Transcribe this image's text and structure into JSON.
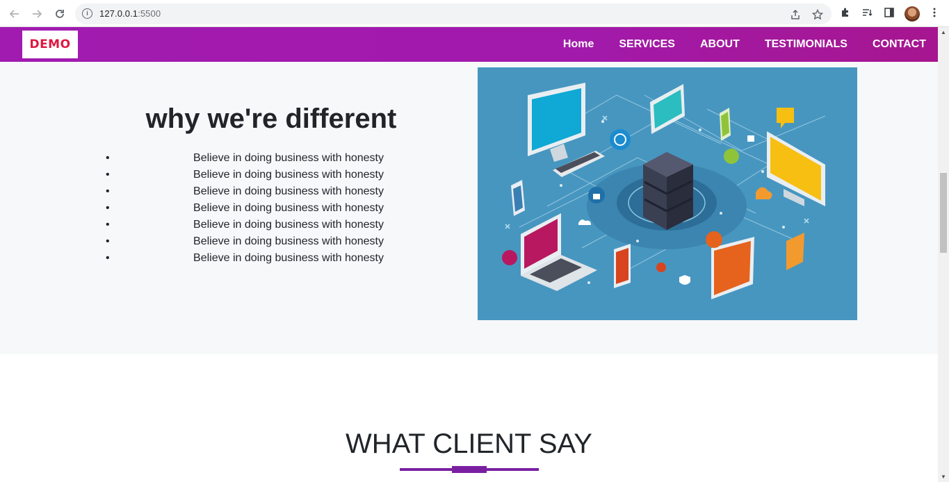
{
  "browser": {
    "url_host": "127.0.0.1",
    "url_port": ":5500",
    "back_icon": "back-arrow-icon",
    "forward_icon": "forward-arrow-icon",
    "reload_icon": "reload-icon"
  },
  "nav": {
    "logo_text": "DEMO",
    "items": [
      "Home",
      "SERVICES",
      "ABOUT",
      "TESTIMONIALS",
      "CONTACT"
    ],
    "gradient_start": "#a11bb0",
    "gradient_end": "#a6168f"
  },
  "different": {
    "title": "why we're different",
    "points": [
      "Believe in doing business with honesty",
      "Believe in doing business with honesty",
      "Believe in doing business with honesty",
      "Believe in doing business with honesty",
      "Believe in doing business with honesty",
      "Believe in doing business with honesty",
      "Believe in doing business with honesty"
    ],
    "illustration": "network-server-illustration"
  },
  "testimonials": {
    "title": "WHAT CLIENT SAY",
    "accent": "#7b1fa2"
  }
}
